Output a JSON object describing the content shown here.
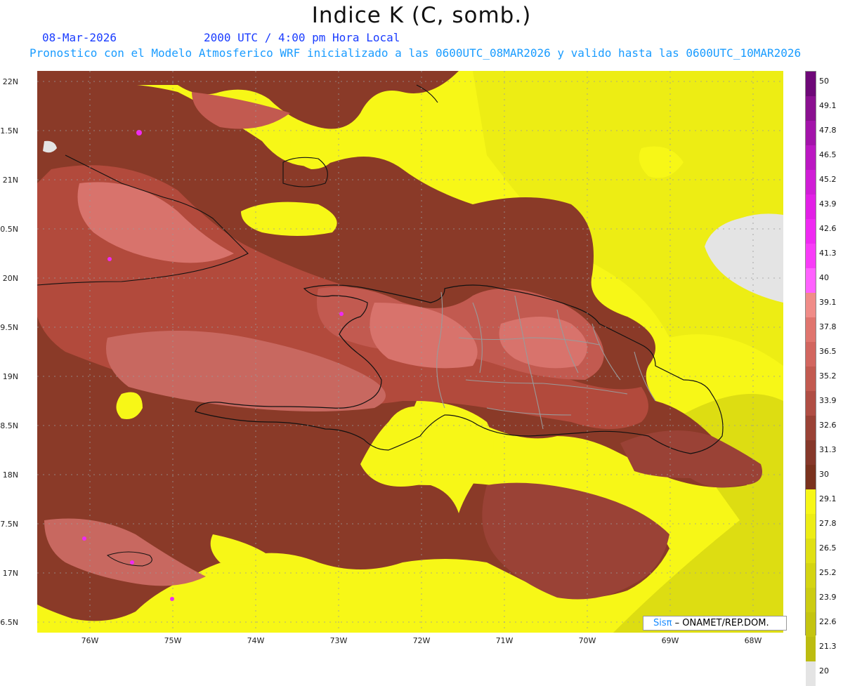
{
  "title": "Indice K (C, somb.)",
  "date": "08-Mar-2026",
  "time": "2000 UTC / 4:00 pm Hora Local",
  "forecast": "Pronostico con el Modelo Atmosferico WRF inicializado a las 0600UTC_08MAR2026 y valido hasta las  0600UTC_10MAR2026",
  "lat_labels": [
    "22N",
    "1.5N",
    "21N",
    "0.5N",
    "20N",
    "9.5N",
    "19N",
    "8.5N",
    "18N",
    "7.5N",
    "17N",
    "6.5N"
  ],
  "lon_labels": [
    "76W",
    "75W",
    "74W",
    "73W",
    "72W",
    "71W",
    "70W",
    "69W",
    "68W"
  ],
  "colorbar": {
    "labels": [
      "50",
      "49.1",
      "47.8",
      "46.5",
      "45.2",
      "43.9",
      "42.6",
      "41.3",
      "40",
      "39.1",
      "37.8",
      "36.5",
      "35.2",
      "33.9",
      "32.6",
      "31.3",
      "30",
      "29.1",
      "27.8",
      "26.5",
      "25.2",
      "23.9",
      "22.6",
      "21.3",
      "20"
    ],
    "colors": [
      "#6e0878",
      "#8a1090",
      "#a314aa",
      "#bb18c2",
      "#d01ed6",
      "#e220e6",
      "#ef2af2",
      "#f83cf8",
      "#ff62ff",
      "#f08c88",
      "#e0756e",
      "#d2665f",
      "#c25a50",
      "#b04e44",
      "#9a4236",
      "#86382a",
      "#7a321e",
      "#f7f717",
      "#eded15",
      "#e0e014",
      "#d4d412",
      "#cccc12",
      "#c4c410",
      "#bcbc10",
      "#e4e4e4"
    ]
  },
  "credit": {
    "brand": "Sisπ",
    "text": "– ONAMET/REP.DOM."
  },
  "map": {
    "region": "Hispaniola / Caribbean",
    "colors": {
      "land": "#b24a3c",
      "high": "#d8736c",
      "base": "#8a3a28",
      "low": "#f7f717",
      "nodata": "#e4e4e4",
      "coast": "#111111",
      "border": "#9a9a9a"
    }
  }
}
